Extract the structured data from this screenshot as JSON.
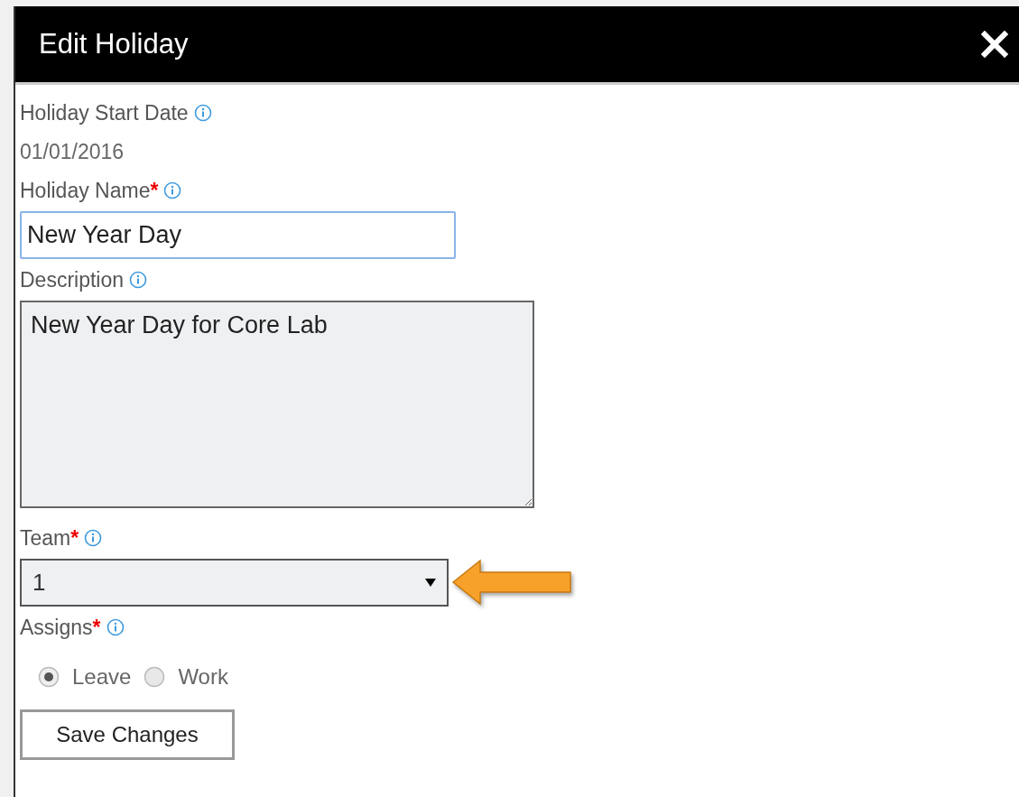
{
  "dialog": {
    "title": "Edit Holiday"
  },
  "fields": [
    {
      "kind": "static",
      "label": "Holiday Start Date",
      "value": "01/01/2016"
    },
    {
      "kind": "text",
      "label": "Holiday Name",
      "marker": "*",
      "value": "New Year Day",
      "focused": true
    },
    {
      "kind": "textarea",
      "label": "Description",
      "value": "New Year Day for Core Lab"
    },
    {
      "kind": "select",
      "label": "Team",
      "marker": "*",
      "value": "1",
      "pointed": true
    },
    {
      "kind": "radio",
      "label": "Assigns",
      "marker": "*",
      "options": [
        {
          "label": "Leave",
          "selected": true
        },
        {
          "label": "Work",
          "selected": false
        }
      ]
    }
  ],
  "save_button": "Save Changes"
}
